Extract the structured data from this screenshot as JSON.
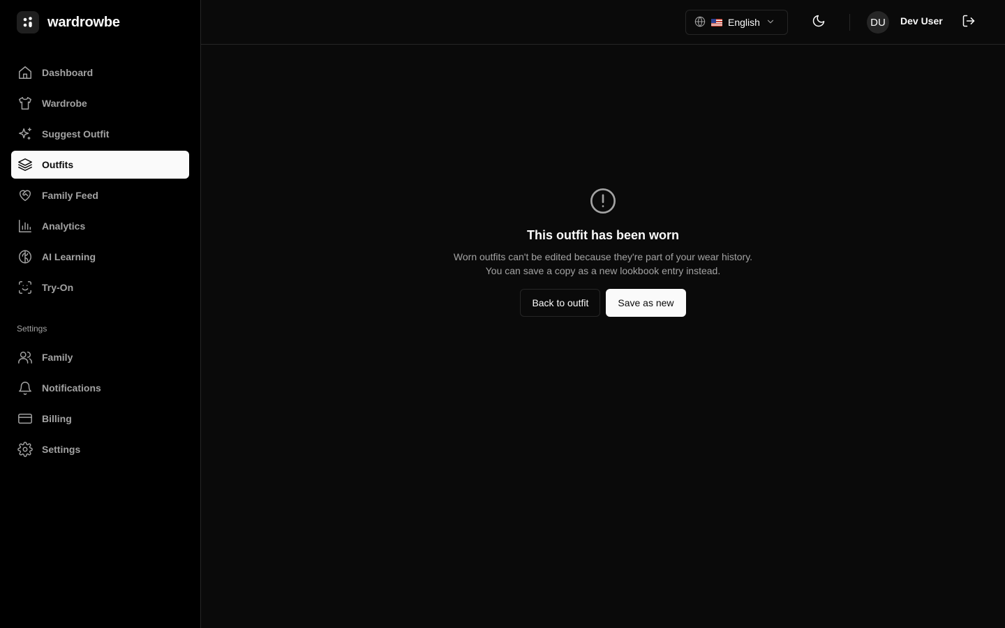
{
  "brand": {
    "name": "wardrowbe",
    "logo_icon": "dots-logo-icon"
  },
  "sidebar": {
    "main_items": [
      {
        "label": "Dashboard",
        "icon": "home-icon",
        "active": false
      },
      {
        "label": "Wardrobe",
        "icon": "shirt-icon",
        "active": false
      },
      {
        "label": "Suggest Outfit",
        "icon": "sparkles-icon",
        "active": false
      },
      {
        "label": "Outfits",
        "icon": "layers-icon",
        "active": true
      },
      {
        "label": "Family Feed",
        "icon": "heart-handshake-icon",
        "active": false
      },
      {
        "label": "Analytics",
        "icon": "bar-chart-icon",
        "active": false
      },
      {
        "label": "AI Learning",
        "icon": "brain-icon",
        "active": false
      },
      {
        "label": "Try-On",
        "icon": "scan-face-icon",
        "active": false
      }
    ],
    "settings_title": "Settings",
    "settings_items": [
      {
        "label": "Family",
        "icon": "users-icon"
      },
      {
        "label": "Notifications",
        "icon": "bell-icon"
      },
      {
        "label": "Billing",
        "icon": "credit-card-icon"
      },
      {
        "label": "Settings",
        "icon": "gear-icon"
      }
    ]
  },
  "header": {
    "language": "English",
    "language_icon": "globe-icon",
    "theme_icon": "moon-icon",
    "user_initials": "DU",
    "user_name": "Dev User",
    "logout_icon": "logout-icon"
  },
  "notice": {
    "icon": "alert-circle-icon",
    "title": "This outfit has been worn",
    "description": "Worn outfits can't be edited because they're part of your wear history. You can save a copy as a new lookbook entry instead.",
    "back_label": "Back to outfit",
    "save_label": "Save as new"
  },
  "colors": {
    "background": "#0a0a0a",
    "sidebar": "#000000",
    "border": "#262626",
    "muted_text": "#a3a3a3",
    "foreground": "#fafafa"
  }
}
